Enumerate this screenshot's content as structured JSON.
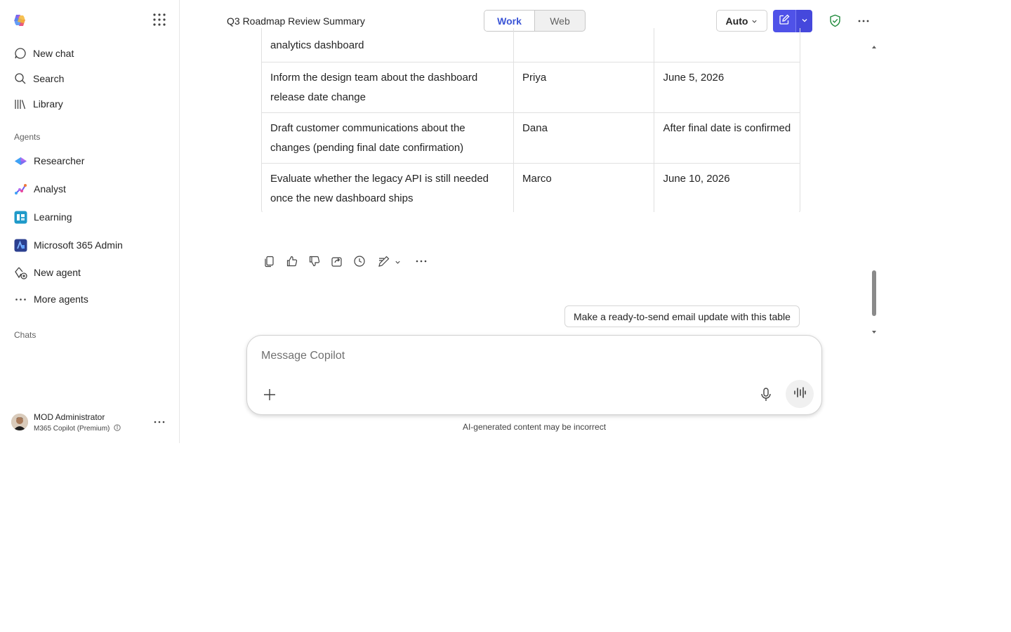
{
  "sidebar": {
    "nav": [
      {
        "label": "New chat",
        "icon": "chat-bubble-icon"
      },
      {
        "label": "Search",
        "icon": "search-icon"
      },
      {
        "label": "Library",
        "icon": "library-icon"
      }
    ],
    "agents_label": "Agents",
    "agents": [
      {
        "label": "Researcher",
        "icon": "researcher-icon"
      },
      {
        "label": "Analyst",
        "icon": "analyst-icon"
      },
      {
        "label": "Learning",
        "icon": "learning-icon"
      },
      {
        "label": "Microsoft 365 Admin",
        "icon": "admin-icon"
      },
      {
        "label": "New agent",
        "icon": "new-agent-icon"
      },
      {
        "label": "More agents",
        "icon": "more-icon"
      }
    ],
    "chats_label": "Chats",
    "user": {
      "name": "MOD Administrator",
      "plan": "M365 Copilot (Premium)"
    }
  },
  "header": {
    "title": "Q3 Roadmap Review Summary",
    "toggle": {
      "work": "Work",
      "web": "Web"
    },
    "model": "Auto"
  },
  "table": {
    "rows": [
      {
        "task": "analytics dashboard",
        "owner": "",
        "due": ""
      },
      {
        "task": "Inform the design team about the dashboard release date change",
        "owner": "Priya",
        "due": "June 5, 2026"
      },
      {
        "task": "Draft customer communications about the changes (pending final date confirmation)",
        "owner": "Dana",
        "due": "After final date is confirmed"
      },
      {
        "task": "Evaluate whether the legacy API is still needed once the new dashboard ships",
        "owner": "Marco",
        "due": "June 10, 2026"
      }
    ]
  },
  "suggestion": "Make a ready-to-send email update with this table",
  "composer": {
    "placeholder": "Message Copilot"
  },
  "disclaimer": "AI-generated content may be incorrect",
  "colors": {
    "accent": "#4f52e8",
    "work_active": "#3b55d6",
    "shield": "#1f8a3b"
  }
}
